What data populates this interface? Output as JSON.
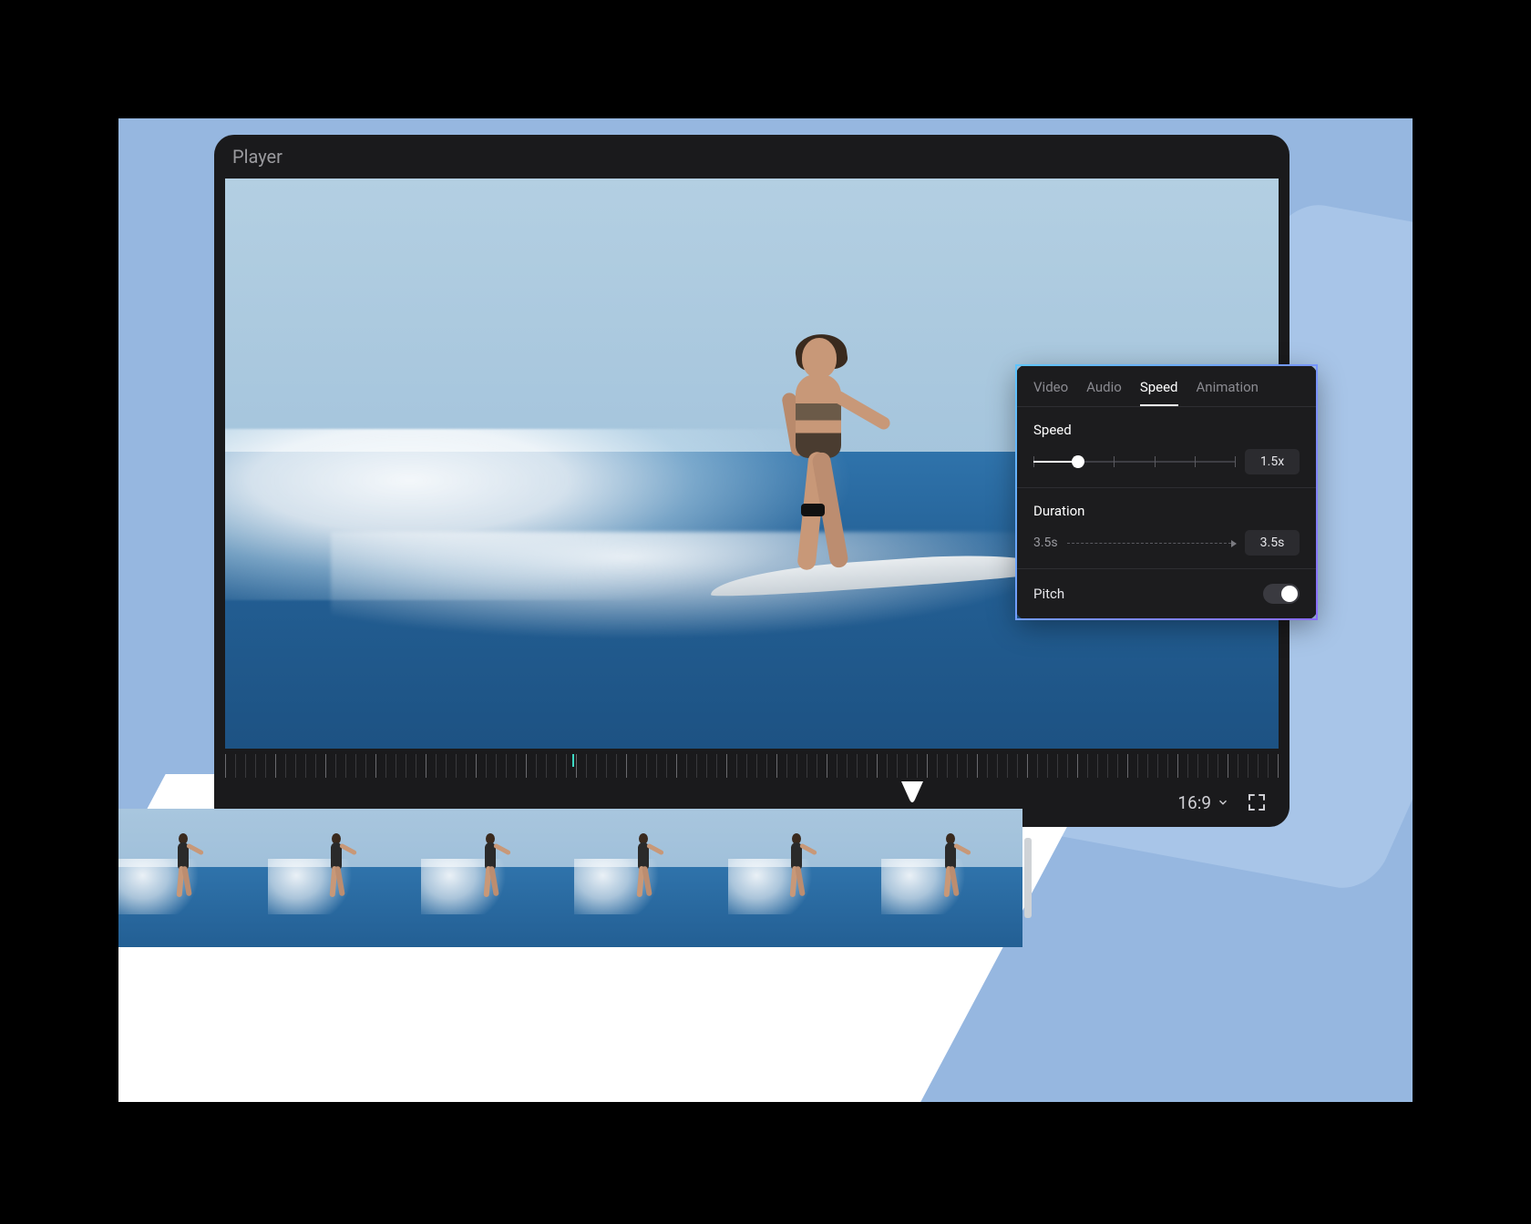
{
  "player": {
    "title": "Player",
    "aspect_ratio": "16:9"
  },
  "properties": {
    "tabs": [
      "Video",
      "Audio",
      "Speed",
      "Animation"
    ],
    "active_tab": "Speed",
    "speed": {
      "label": "Speed",
      "value_text": "1.5x",
      "slider_percent": 22
    },
    "duration": {
      "label": "Duration",
      "from_text": "3.5s",
      "to_text": "3.5s"
    },
    "pitch": {
      "label": "Pitch",
      "enabled": false
    }
  },
  "timeline": {
    "frame_count": 6,
    "ruler_marker_percent": 33
  }
}
